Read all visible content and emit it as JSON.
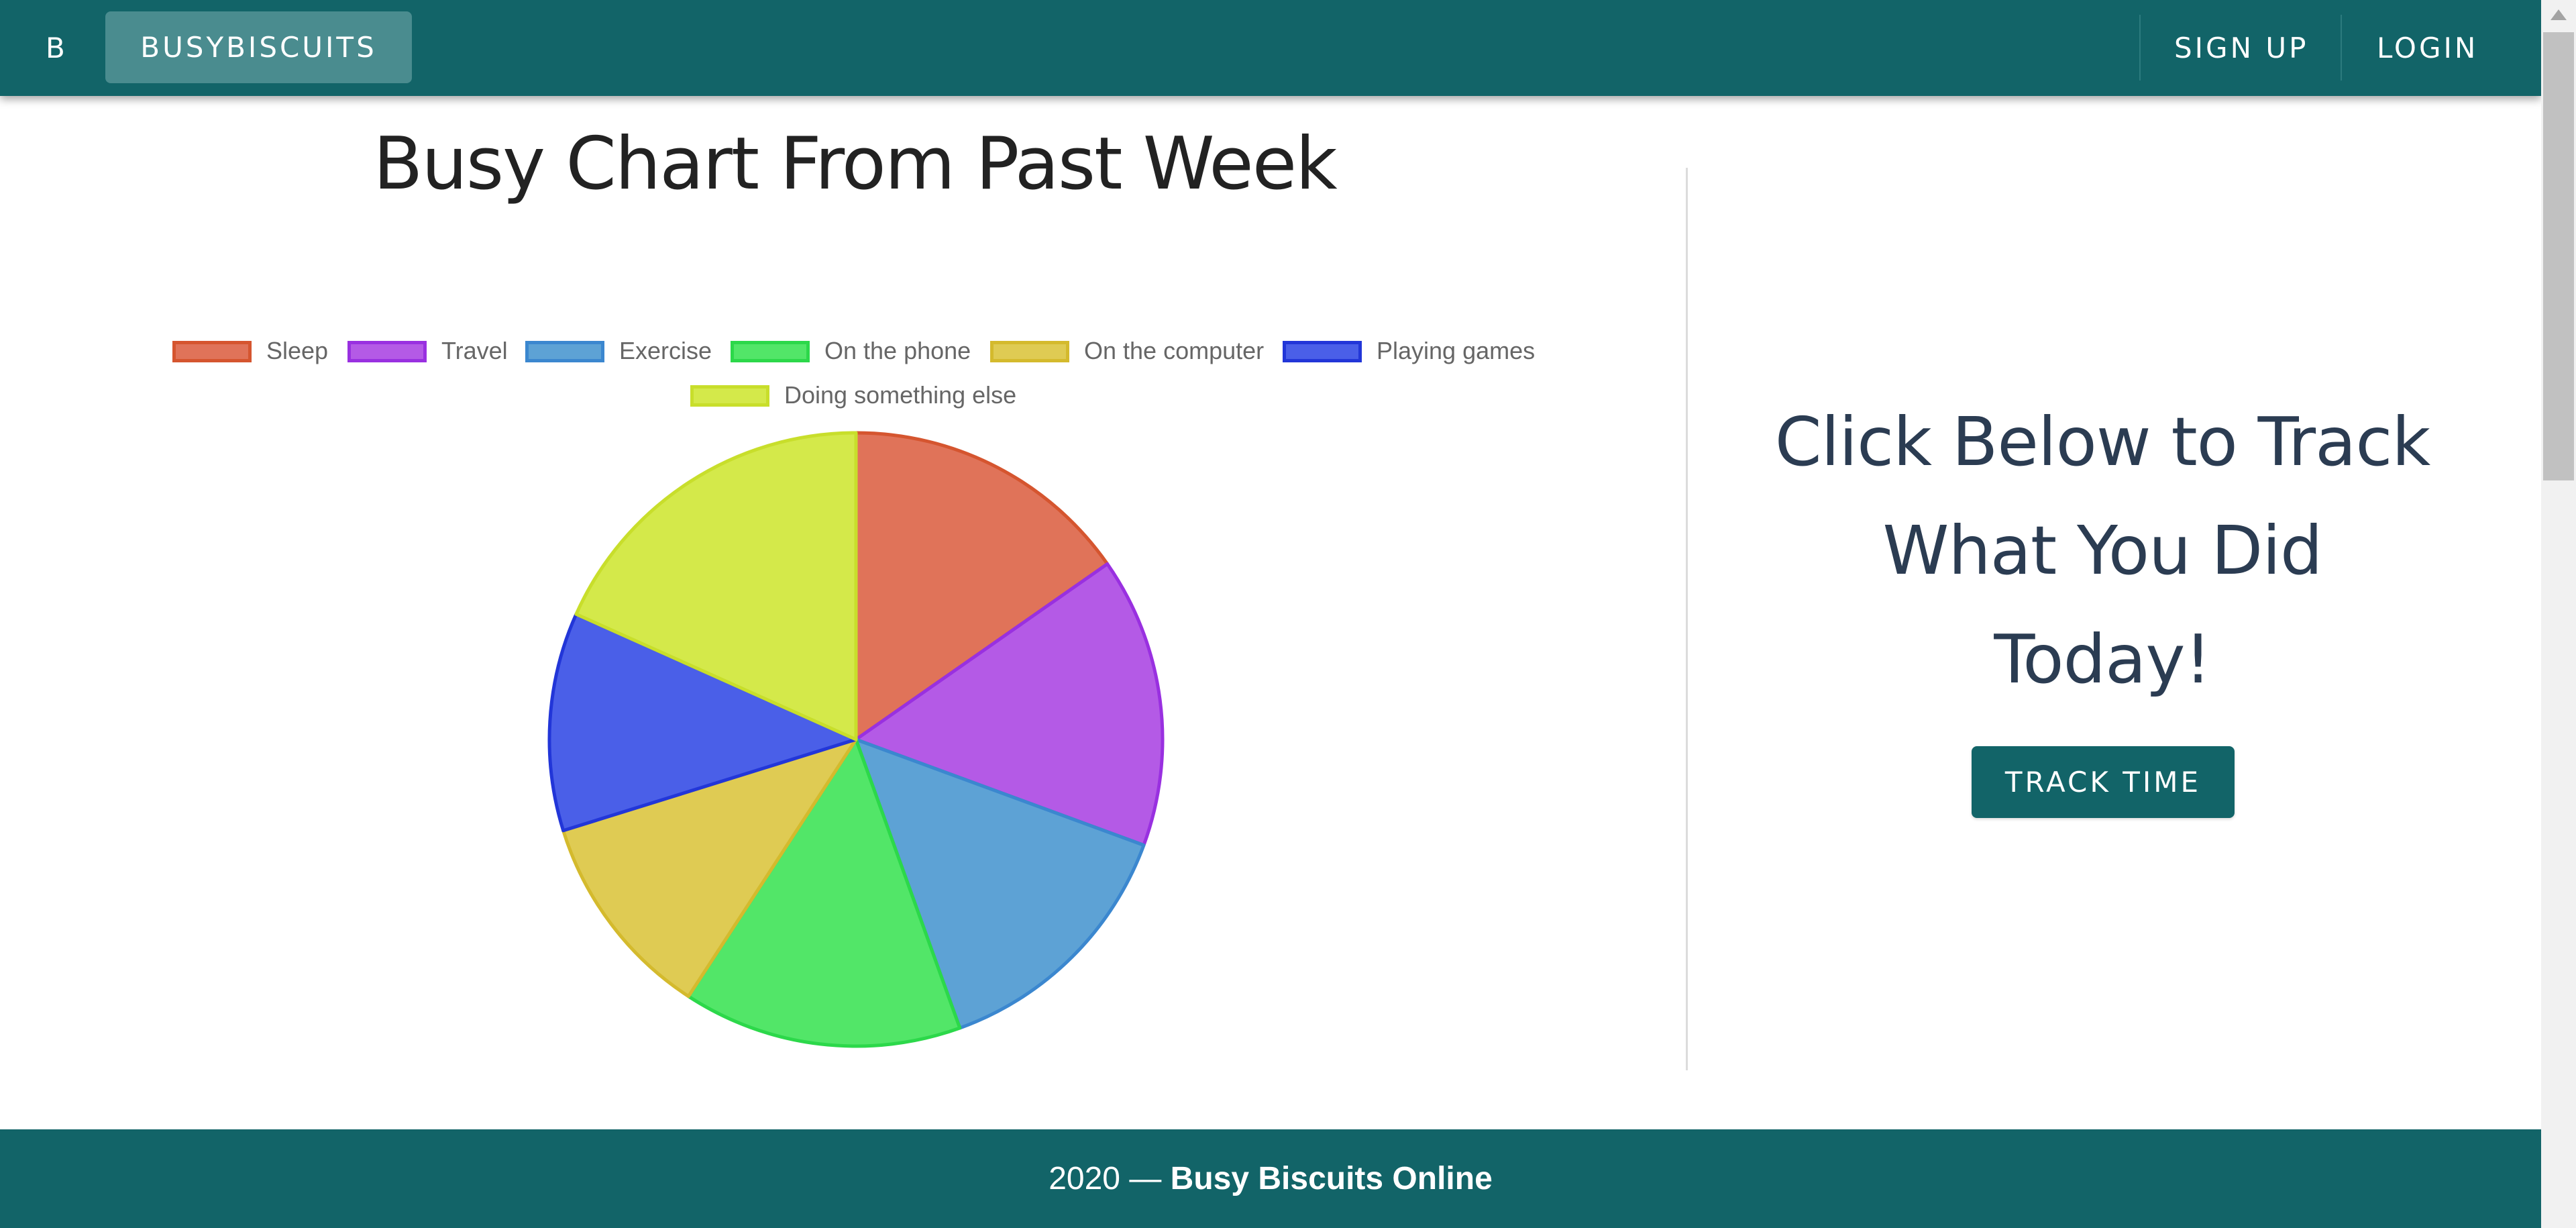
{
  "navbar": {
    "brand_letter": "B",
    "brand_name": "BUSYBISCUITS",
    "sign_up": "SIGN UP",
    "login": "LOGIN",
    "color": "#126468"
  },
  "chart_data": {
    "type": "pie",
    "title": "Busy Chart From Past Week",
    "legend_position": "top",
    "categories": [
      "Sleep",
      "Travel",
      "Exercise",
      "On the phone",
      "On the computer",
      "Playing games",
      "Doing something else"
    ],
    "values": [
      15.3,
      15.3,
      13.9,
      14.7,
      11.0,
      11.5,
      18.3
    ],
    "colors": [
      "#e07359",
      "#b45ae6",
      "#5da2d5",
      "#52e668",
      "#dfcb53",
      "#4a5fe8",
      "#d4e94a"
    ],
    "border_colors": [
      "#d5552f",
      "#9930e0",
      "#3b87cf",
      "#2cd84a",
      "#d4ba2d",
      "#2236d8",
      "#c8de2b"
    ]
  },
  "cta": {
    "heading_lines": [
      "Click Below to Track",
      "What You Did",
      "Today!"
    ],
    "button_label": "TRACK TIME"
  },
  "footer": {
    "year_text": "2020 — ",
    "site_name": "Busy Biscuits Online"
  }
}
